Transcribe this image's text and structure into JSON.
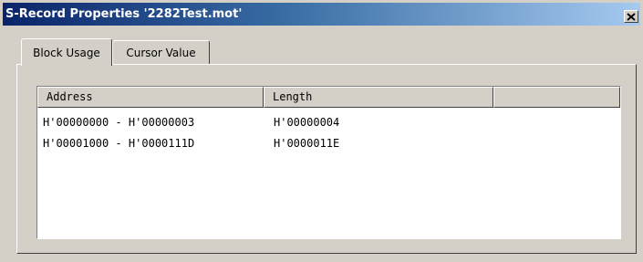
{
  "window": {
    "title": "S-Record Properties '2282Test.mot'",
    "close_glyph": "×"
  },
  "tabs": [
    {
      "label": "Block Usage",
      "active": true
    },
    {
      "label": "Cursor Value",
      "active": false
    }
  ],
  "table": {
    "columns": [
      "Address",
      "Length",
      ""
    ],
    "rows": [
      {
        "address": "H'00000000 - H'00000003",
        "length": "H'00000004"
      },
      {
        "address": "H'00001000 - H'0000111D",
        "length": "H'0000011E"
      }
    ]
  },
  "colors": {
    "titlebar_start": "#0a246a",
    "titlebar_end": "#a6caf0",
    "face": "#d4d0c8"
  }
}
